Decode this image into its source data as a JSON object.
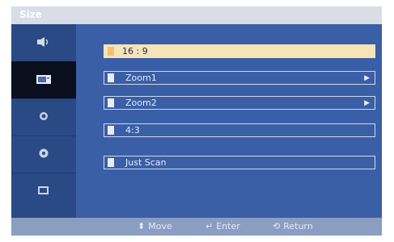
{
  "window": {
    "title": "Size"
  },
  "sidebar": {
    "items": [
      {
        "icon": "speaker-icon"
      },
      {
        "icon": "picture-icon"
      },
      {
        "icon": "channel-icon"
      },
      {
        "icon": "setup-icon"
      },
      {
        "icon": "input-icon"
      }
    ]
  },
  "menu": {
    "options": [
      {
        "label": "16 : 9",
        "selected": true,
        "has_arrow": false
      },
      {
        "label": "Zoom1",
        "selected": false,
        "has_arrow": true
      },
      {
        "label": "Zoom2",
        "selected": false,
        "has_arrow": true
      },
      {
        "label": "4:3",
        "selected": false,
        "has_arrow": false
      },
      {
        "label": "Just Scan",
        "selected": false,
        "has_arrow": false
      }
    ]
  },
  "status": {
    "move": "Move",
    "enter": "Enter",
    "return": "Return"
  },
  "colors": {
    "accent": "#f6e3b8",
    "panel": "#3a5fa6",
    "sidebar": "#2a4a85"
  }
}
